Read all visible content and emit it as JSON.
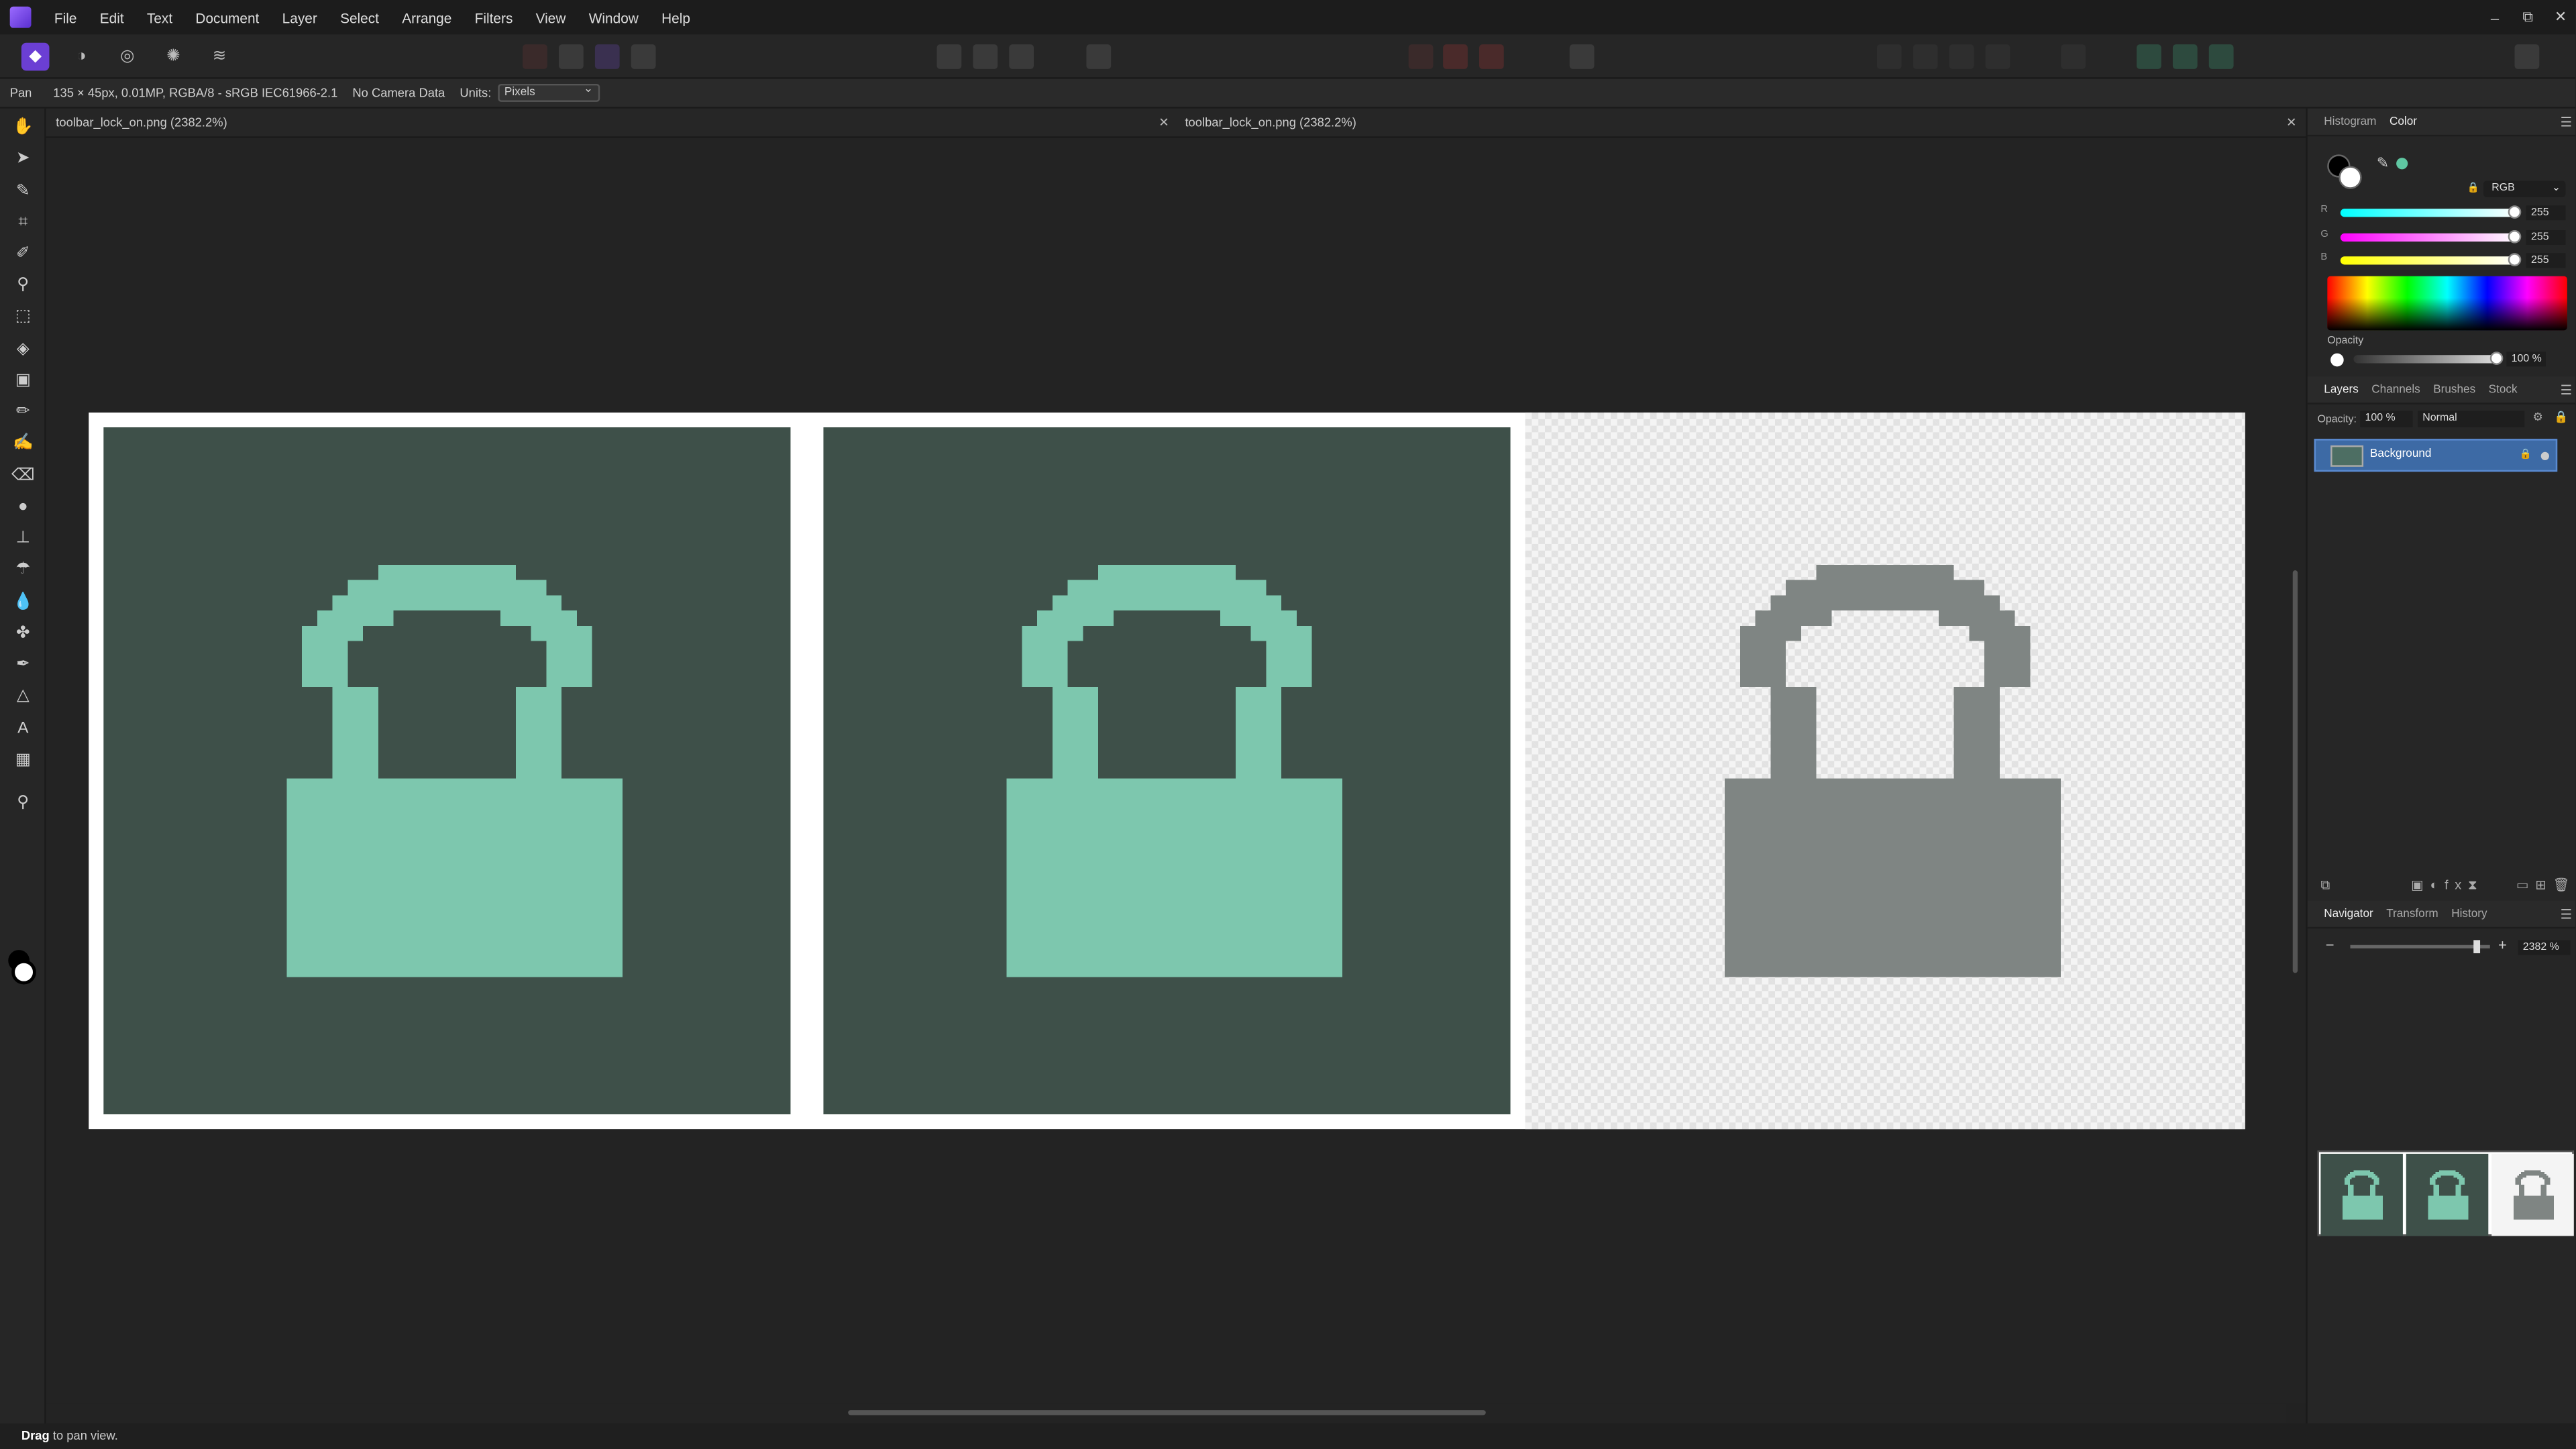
{
  "app": {
    "name": "Affinity Photo"
  },
  "menu": [
    "File",
    "Edit",
    "Text",
    "Document",
    "Layer",
    "Select",
    "Arrange",
    "Filters",
    "View",
    "Window",
    "Help"
  ],
  "window_controls": {
    "minimize": "–",
    "restore": "⧉",
    "close": "✕"
  },
  "context": {
    "tool_name": "Pan",
    "doc_info": "135 × 45px, 0.01MP, RGBA/8 - sRGB IEC61966-2.1",
    "camera": "No Camera Data",
    "units_label": "Units:",
    "units_value": "Pixels"
  },
  "tabs": [
    {
      "label": "toolbar_lock_on.png (2382.2%)"
    },
    {
      "label": "toolbar_lock_on.png (2382.2%)"
    }
  ],
  "tab_close": "✕",
  "canvas": {
    "lock_color_on": "#7dc7ae",
    "lock_color_off": "#7f8583",
    "tile_bg": "#3e5049"
  },
  "color_panel": {
    "tabs": [
      "Histogram",
      "Color"
    ],
    "model": "RGB",
    "r_label": "R",
    "r_value": "255",
    "g_label": "G",
    "g_value": "255",
    "b_label": "B",
    "b_value": "255",
    "opacity_label": "Opacity",
    "opacity_value": "100 %"
  },
  "layers_panel": {
    "tabs": [
      "Layers",
      "Channels",
      "Brushes",
      "Stock"
    ],
    "opacity_label": "Opacity:",
    "opacity_value": "100 %",
    "blend_mode": "Normal",
    "layers": [
      {
        "name": "Background"
      }
    ]
  },
  "navigator_panel": {
    "tabs": [
      "Navigator",
      "Transform",
      "History"
    ],
    "zoom_value": "2382 %",
    "zoom_fraction": 0.9
  },
  "status": {
    "bold": "Drag",
    "rest": " to pan view."
  }
}
